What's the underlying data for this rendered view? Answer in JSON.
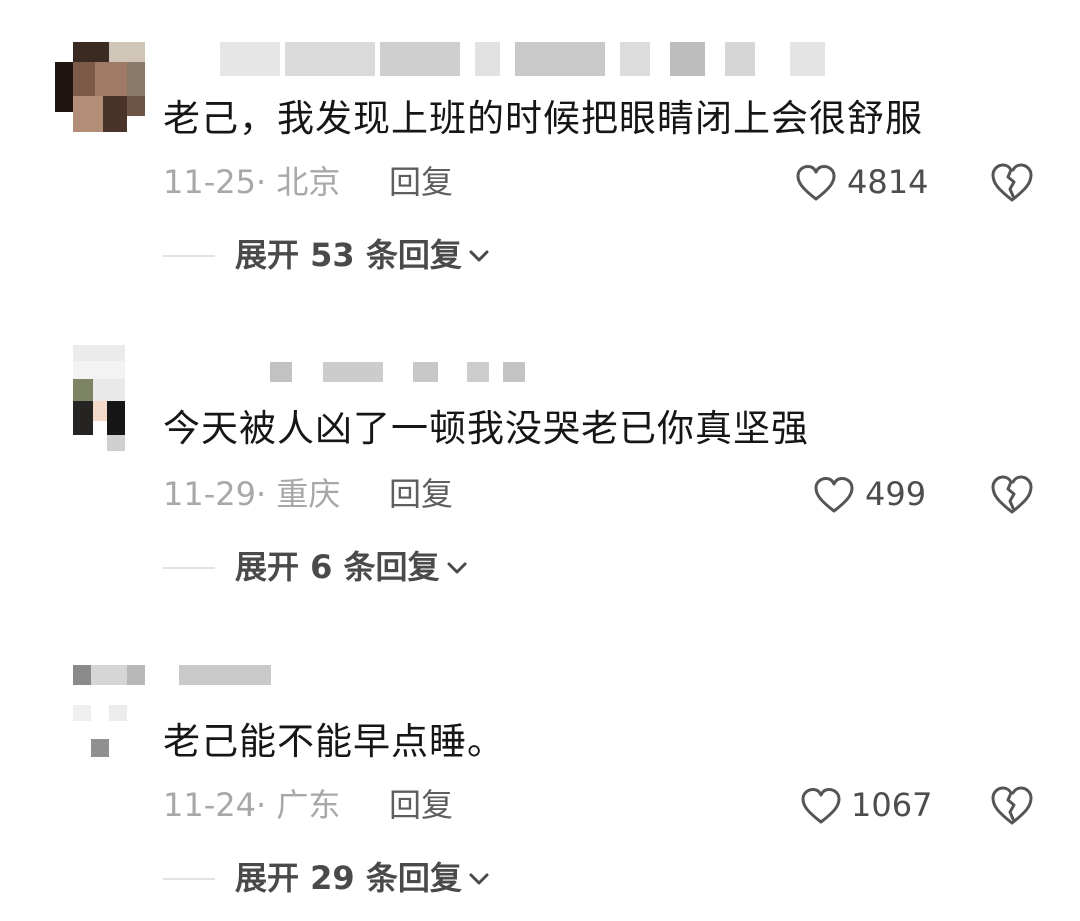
{
  "comments": [
    {
      "text": "老己，我发现上班的时候把眼睛闭上会很舒服",
      "date_location": "11-25· 北京",
      "reply_label": "回复",
      "likes": "4814",
      "expand_label": "展开 53 条回复"
    },
    {
      "text": "今天被人凶了一顿我没哭老已你真坚强",
      "date_location": "11-29· 重庆",
      "reply_label": "回复",
      "likes": "499",
      "expand_label": "展开 6 条回复"
    },
    {
      "text": "老己能不能早点睡。",
      "date_location": "11-24· 广东",
      "reply_label": "回复",
      "likes": "1067",
      "expand_label": "展开 29 条回复"
    }
  ],
  "icons": {
    "like": "heart-outline-icon",
    "dislike": "broken-heart-icon",
    "expand": "chevron-down-icon"
  },
  "colors": {
    "text": "#161616",
    "meta": "#a8a8a8",
    "reply": "#5e5e5e",
    "icon": "#555555"
  }
}
